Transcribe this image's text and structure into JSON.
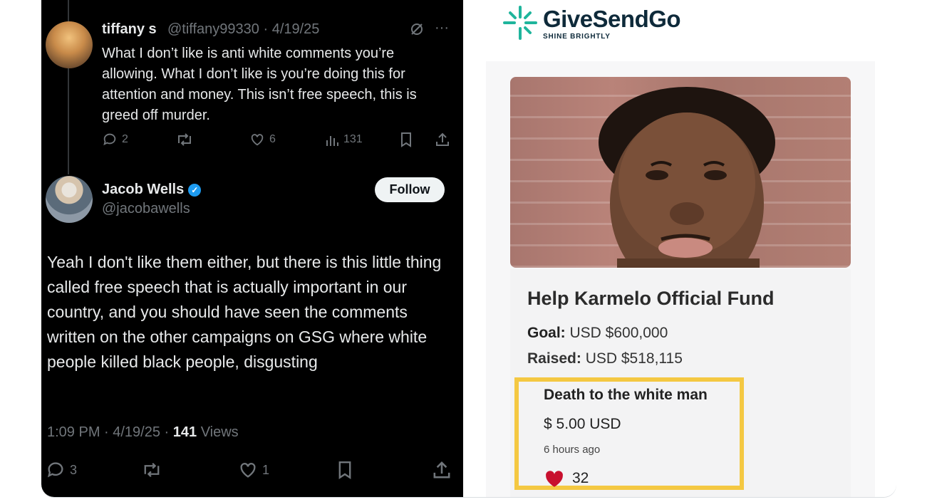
{
  "tweet1": {
    "name": "tiffany s",
    "handle_date": "@tiffany99330 · 4/19/25",
    "body": "What I don’t like is anti white comments you’re allowing. What I don’t like is you’re doing this for attention and money. This isn’t free speech, this is greed off murder.",
    "more": "···",
    "replies": "2",
    "likes": "6",
    "views": "131"
  },
  "tweet2": {
    "name": "Jacob Wells",
    "handle": "@jacobawells",
    "follow_label": "Follow",
    "body": "Yeah I don't like them either, but there is this little thing called free speech that is actually important in our country, and you should have seen the comments written on the other campaigns on GSG where white people killed black people, disgusting",
    "meta_prefix": "1:09 PM · 4/19/25 · ",
    "views_count": "141",
    "views_label": " Views",
    "replies": "3",
    "likes": "1"
  },
  "givesendgo": {
    "brand": "GiveSendGo",
    "tagline": "SHINE BRIGHTLY",
    "fund_title": "Help Karmelo Official Fund",
    "goal_label": "Goal:",
    "goal_value": " USD $600,000",
    "raised_label": "Raised:",
    "raised_value": " USD $518,115",
    "donation": {
      "message": "Death to the white man",
      "amount": "$ 5.00 USD",
      "time": "6 hours ago",
      "likes": "32"
    }
  },
  "colors": {
    "highlight": "#f4c842",
    "heart": "#c8102e",
    "verified": "#1d9bf0"
  }
}
